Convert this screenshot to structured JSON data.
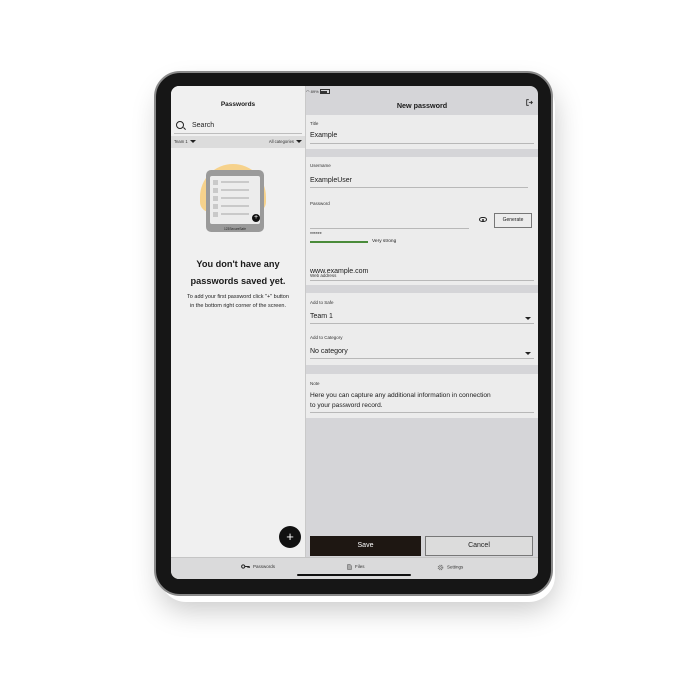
{
  "status_bar": {
    "time": "15:33",
    "date": "Donnerstag 15. Aug.",
    "battery": "89%"
  },
  "sidebar": {
    "title": "Passwords",
    "search_placeholder": "Search",
    "team_filter": "Team 1",
    "category_filter": "All categories",
    "illustration_brand": "123SecureSafe",
    "empty_heading_line1": "You don't have any",
    "empty_heading_line2": "passwords saved yet.",
    "empty_text_line1": "To add your first password click \"+\" button",
    "empty_text_line2": "in the bottom right corner of the screen.",
    "fab_label": "+"
  },
  "form": {
    "title": "New password",
    "title_label": "Title",
    "title_value": "Example",
    "username_label": "Username",
    "username_value": "ExampleUser",
    "password_label": "Password",
    "password_mask": "******",
    "generate_label": "Generate",
    "strength_label": "Very strong",
    "web_label": "Web address",
    "web_value": "www.example.com",
    "safe_label": "Add to Safe",
    "safe_value": "Team 1",
    "category_label": "Add to Category",
    "category_value": "No category",
    "note_label": "Note",
    "note_line1": "Here you can capture any additional information in connection",
    "note_line2": "to your password record.",
    "save_label": "Save",
    "cancel_label": "Cancel"
  },
  "tabbar": {
    "passwords": "Passwords",
    "files": "Files",
    "settings": "Settings"
  },
  "colors": {
    "accent_dark": "#1e1712",
    "strength_green": "#4a8b3a",
    "illustration_yellow": "#f6d28c"
  },
  "icons": [
    "search-icon",
    "chevron-down-icon",
    "eye-icon",
    "logout-icon",
    "key-icon",
    "file-icon",
    "gear-icon",
    "plus-icon"
  ]
}
